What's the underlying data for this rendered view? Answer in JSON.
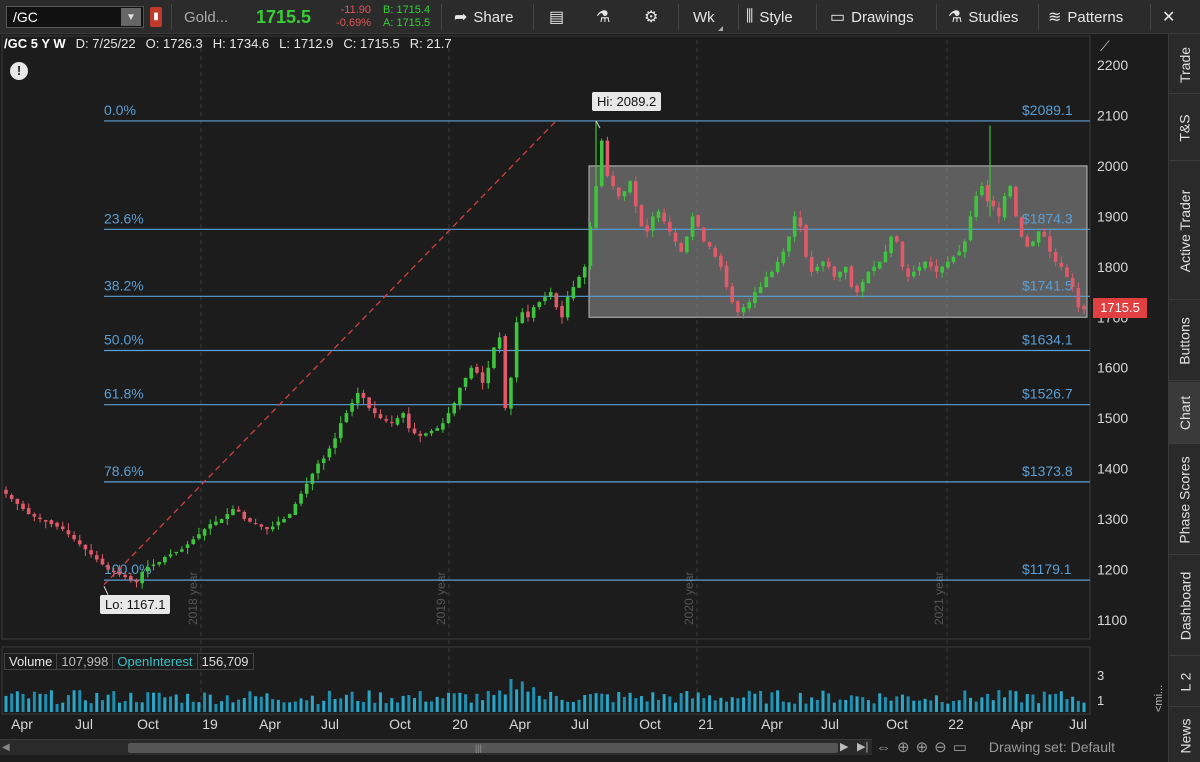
{
  "toolbar": {
    "symbol": "/GC",
    "description": "Gold...",
    "last": "1715.5",
    "change": "-11.90",
    "change_pct": "-0.69%",
    "bid": "B: 1715.4",
    "ask": "A: 1715.5",
    "share": "Share",
    "aggregation": "Wk",
    "style": "Style",
    "drawings": "Drawings",
    "studies": "Studies",
    "patterns": "Patterns"
  },
  "ohlc": {
    "symbol_period": "/GC 5 Y W",
    "date": "D: 7/25/22",
    "open": "O: 1726.3",
    "high": "H: 1734.6",
    "low": "L: 1712.9",
    "close": "C: 1715.5",
    "range": "R: 21.7"
  },
  "callouts": {
    "hi": "Hi: 2089.2",
    "lo": "Lo: 1167.1",
    "current_price": "1715.5"
  },
  "fib_levels": [
    {
      "pct": "0.0%",
      "price": "$2089.1",
      "value": 2089.1
    },
    {
      "pct": "23.6%",
      "price": "$1874.3",
      "value": 1874.3
    },
    {
      "pct": "38.2%",
      "price": "$1741.5",
      "value": 1741.5
    },
    {
      "pct": "50.0%",
      "price": "$1634.1",
      "value": 1634.1
    },
    {
      "pct": "61.8%",
      "price": "$1526.7",
      "value": 1526.7
    },
    {
      "pct": "78.6%",
      "price": "$1373.8",
      "value": 1373.8
    },
    {
      "pct": "100.0%",
      "price": "$1179.1",
      "value": 1179.1
    }
  ],
  "price_axis": [
    "2200",
    "2100",
    "2000",
    "1900",
    "1800",
    "1700",
    "1600",
    "1500",
    "1400",
    "1300",
    "1200",
    "1100"
  ],
  "year_markers": [
    "2018 year",
    "2019 year",
    "2020 year",
    "2021 year"
  ],
  "time_axis": [
    "Apr",
    "Jul",
    "Oct",
    "19",
    "Apr",
    "Jul",
    "Oct",
    "20",
    "Apr",
    "Jul",
    "Oct",
    "21",
    "Apr",
    "Jul",
    "Oct",
    "22",
    "Apr",
    "Jul"
  ],
  "volume_panel": {
    "volume_label": "Volume",
    "volume_value": "107,998",
    "oi_label": "OpenInterest",
    "oi_value": "156,709",
    "axis": [
      "3",
      "1"
    ]
  },
  "bottom": {
    "drawing_set": "Drawing set: Default"
  },
  "side_tabs": [
    "Trade",
    "T&S",
    "Active Trader",
    "Buttons",
    "Chart",
    "Phase Scores",
    "Dashboard",
    "L 2",
    "News"
  ],
  "colors": {
    "up": "#3ec43e",
    "down": "#e05a6a",
    "fib_line": "#5b9fd4",
    "box_fill": "#8a8a8a",
    "price_tag": "#e04040",
    "trend_line": "#d04040"
  },
  "chart_data": {
    "type": "candlestick",
    "title": "/GC 5 Y W",
    "y_range": [
      1080,
      2220
    ],
    "weekly_closes": [
      1350,
      1340,
      1330,
      1320,
      1310,
      1305,
      1300,
      1295,
      1290,
      1285,
      1280,
      1270,
      1260,
      1250,
      1240,
      1230,
      1220,
      1210,
      1200,
      1195,
      1190,
      1185,
      1180,
      1175,
      1195,
      1205,
      1210,
      1215,
      1225,
      1230,
      1235,
      1240,
      1250,
      1260,
      1270,
      1280,
      1290,
      1295,
      1300,
      1310,
      1320,
      1315,
      1300,
      1295,
      1290,
      1285,
      1280,
      1285,
      1295,
      1300,
      1310,
      1330,
      1350,
      1370,
      1390,
      1410,
      1420,
      1440,
      1460,
      1490,
      1510,
      1530,
      1550,
      1540,
      1520,
      1510,
      1500,
      1495,
      1490,
      1500,
      1510,
      1480,
      1470,
      1465,
      1470,
      1475,
      1480,
      1490,
      1510,
      1530,
      1560,
      1580,
      1600,
      1590,
      1570,
      1600,
      1640,
      1660,
      1520,
      1580,
      1690,
      1710,
      1700,
      1720,
      1730,
      1740,
      1750,
      1720,
      1700,
      1740,
      1760,
      1780,
      1800,
      1880,
      1960,
      2050,
      1980,
      1960,
      1940,
      1950,
      1970,
      1920,
      1880,
      1870,
      1900,
      1910,
      1890,
      1870,
      1850,
      1830,
      1860,
      1900,
      1880,
      1850,
      1840,
      1820,
      1800,
      1760,
      1730,
      1710,
      1720,
      1730,
      1750,
      1760,
      1780,
      1790,
      1810,
      1830,
      1860,
      1900,
      1880,
      1820,
      1790,
      1800,
      1810,
      1800,
      1780,
      1790,
      1800,
      1760,
      1750,
      1770,
      1790,
      1800,
      1810,
      1830,
      1860,
      1850,
      1800,
      1780,
      1790,
      1800,
      1810,
      1800,
      1790,
      1800,
      1810,
      1820,
      1830,
      1850,
      1900,
      1940,
      1960,
      1930,
      1920,
      1900,
      1940,
      1960,
      1900,
      1860,
      1840,
      1850,
      1870,
      1860,
      1830,
      1810,
      1800,
      1780,
      1760,
      1720,
      1715.5
    ]
  }
}
